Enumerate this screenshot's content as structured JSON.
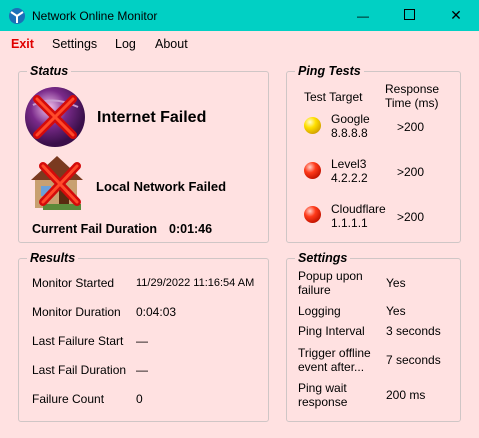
{
  "window": {
    "title": "Network Online Monitor",
    "minimize": "—",
    "close": "✕"
  },
  "menu": {
    "exit": "Exit",
    "settings": "Settings",
    "log": "Log",
    "about": "About"
  },
  "status": {
    "legend": "Status",
    "internet": "Internet Failed",
    "local": "Local Network Failed",
    "fail_label": "Current Fail Duration",
    "fail_value": "0:01:46"
  },
  "ping": {
    "legend": "Ping Tests",
    "col_target": "Test Target",
    "col_response_1": "Response",
    "col_response_2": "Time (ms)",
    "rows": [
      {
        "name": "Google",
        "ip": "8.8.8.8",
        "response": ">200",
        "status_color": "#ffd400"
      },
      {
        "name": "Level3",
        "ip": "4.2.2.2",
        "response": ">200",
        "status_color": "#ff2a00"
      },
      {
        "name": "Cloudflare",
        "ip": "1.1.1.1",
        "response": ">200",
        "status_color": "#ff2a00"
      }
    ]
  },
  "results": {
    "legend": "Results",
    "rows": [
      {
        "label": "Monitor Started",
        "value": "11/29/2022 11:16:54 AM"
      },
      {
        "label": "Monitor Duration",
        "value": "0:04:03"
      },
      {
        "label": "Last Failure Start",
        "value": "—"
      },
      {
        "label": "Last Fail Duration",
        "value": "—"
      },
      {
        "label": "Failure Count",
        "value": "0"
      }
    ]
  },
  "settings": {
    "legend": "Settings",
    "rows": [
      {
        "label_1": "Popup upon",
        "label_2": "failure",
        "value": "Yes"
      },
      {
        "label_1": "Logging",
        "label_2": "",
        "value": "Yes"
      },
      {
        "label_1": "Ping Interval",
        "label_2": "",
        "value": "3 seconds"
      },
      {
        "label_1": "Trigger offline",
        "label_2": "event after...",
        "value": "7 seconds"
      },
      {
        "label_1": "Ping wait",
        "label_2": "response",
        "value": "200 ms"
      }
    ]
  },
  "colors": {
    "titlebar": "#01d0c4",
    "background": "#ffe1e1",
    "exit": "#e00000"
  },
  "icons": [
    "app-icon",
    "internet-failed-icon",
    "local-network-failed-icon",
    "ping-status-icon"
  ]
}
